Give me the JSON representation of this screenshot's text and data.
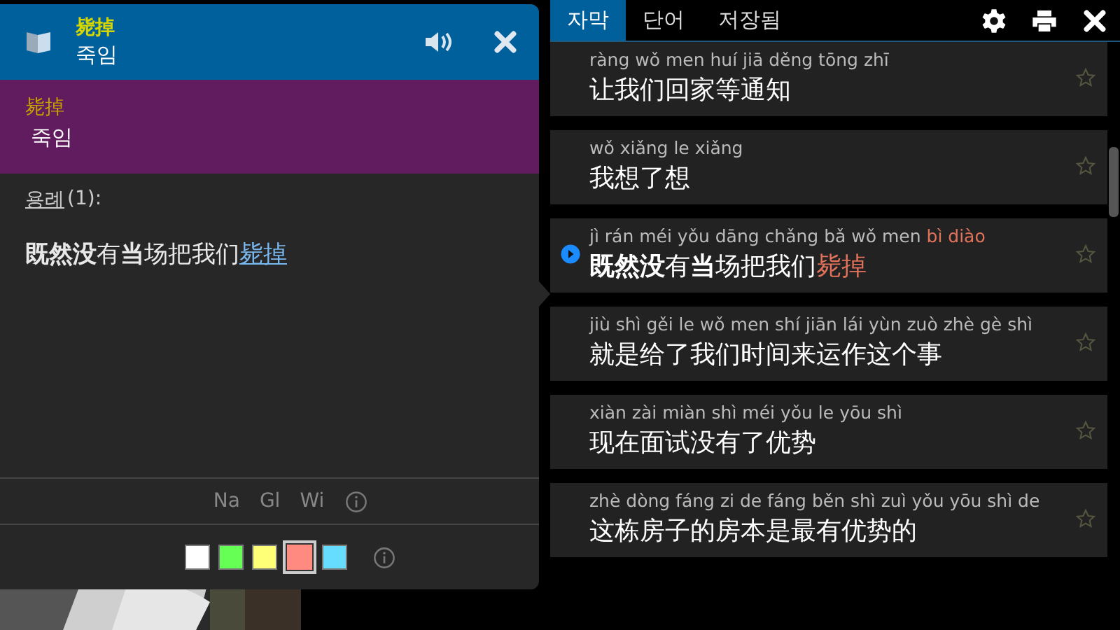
{
  "popup": {
    "word": "毙掉",
    "meaning": "죽임",
    "definition": {
      "word": "毙掉",
      "meaning": "죽임"
    },
    "examples_label": "용례",
    "examples_count": "(1):",
    "example": {
      "text": "**既然没**有**当**场把我们",
      "link": "毙掉"
    },
    "sources": [
      "Na",
      "Gl",
      "Wi"
    ],
    "colors": [
      {
        "color": "#ffffff",
        "selected": false
      },
      {
        "color": "#66ff55",
        "selected": false
      },
      {
        "color": "#ffff77",
        "selected": false
      },
      {
        "color": "#ff8a80",
        "selected": true
      },
      {
        "color": "#66ddff",
        "selected": false
      }
    ]
  },
  "tabs": [
    {
      "label": "자막",
      "selected": true
    },
    {
      "label": "단어",
      "selected": false
    },
    {
      "label": "저장됨",
      "selected": false
    }
  ],
  "subtitles": [
    {
      "pinyin": "ràng wǒ men huí jiā děng tōng zhī",
      "hanzi": "让我们回家等通知",
      "playing": false
    },
    {
      "pinyin": "wǒ xiǎng le xiǎng",
      "hanzi": "我想了想",
      "playing": false
    },
    {
      "pinyin": "jì rán méi yǒu dāng chǎng bǎ wǒ men ",
      "pinyin_highlight": "bì diào",
      "hanzi": "**既然没**有**当**场把我们",
      "hanzi_highlight": "毙掉",
      "playing": true
    },
    {
      "pinyin": "jiù shì gěi le wǒ men shí jiān lái yùn zuò zhè gè shì",
      "hanzi": "就是给了我们时间来运作这个事",
      "playing": false
    },
    {
      "pinyin": "xiàn zài miàn shì méi yǒu le yōu shì",
      "hanzi": "现在面试没有了优势",
      "playing": false
    },
    {
      "pinyin": "zhè dòng fáng zi de fáng běn shì zuì yǒu yōu shì de",
      "hanzi": "这栋房子的房本是最有优势的",
      "playing": false
    }
  ]
}
